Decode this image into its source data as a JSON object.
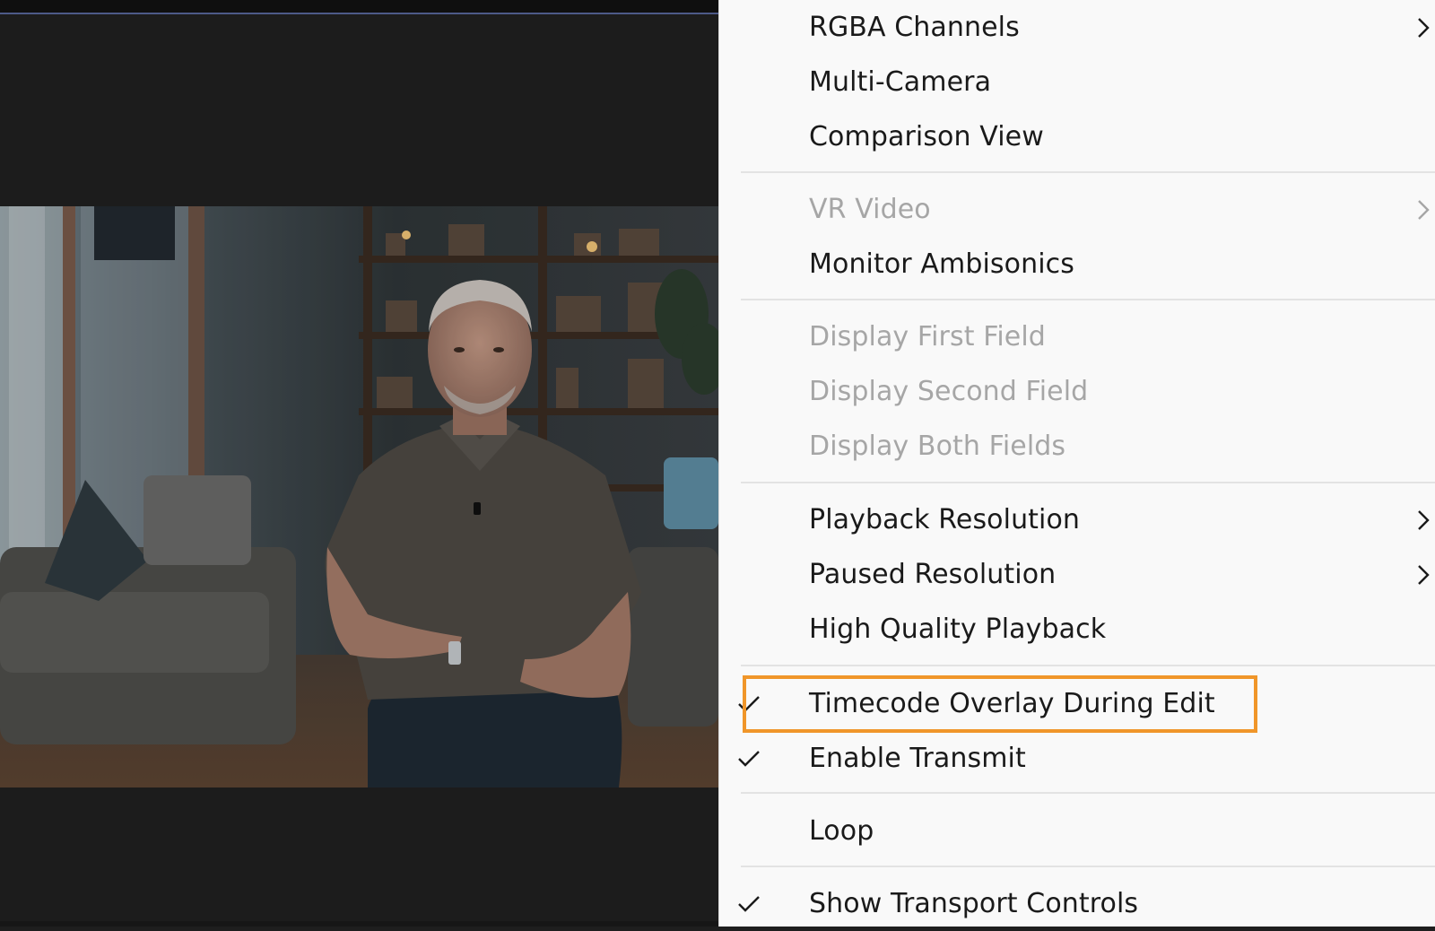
{
  "monitor": {
    "preview_name": "video-preview"
  },
  "menu": {
    "items": [
      {
        "label": "RGBA Channels",
        "enabled": true,
        "checked": false,
        "submenu": true
      },
      {
        "label": "Multi-Camera",
        "enabled": true,
        "checked": false,
        "submenu": false
      },
      {
        "label": "Comparison View",
        "enabled": true,
        "checked": false,
        "submenu": false
      },
      {
        "label": "VR Video",
        "enabled": false,
        "checked": false,
        "submenu": true
      },
      {
        "label": "Monitor Ambisonics",
        "enabled": true,
        "checked": false,
        "submenu": false
      },
      {
        "label": "Display First Field",
        "enabled": false,
        "checked": false,
        "submenu": false
      },
      {
        "label": "Display Second Field",
        "enabled": false,
        "checked": false,
        "submenu": false
      },
      {
        "label": "Display Both Fields",
        "enabled": false,
        "checked": false,
        "submenu": false
      },
      {
        "label": "Playback Resolution",
        "enabled": true,
        "checked": false,
        "submenu": true
      },
      {
        "label": "Paused Resolution",
        "enabled": true,
        "checked": false,
        "submenu": true
      },
      {
        "label": "High Quality Playback",
        "enabled": true,
        "checked": false,
        "submenu": false
      },
      {
        "label": "Timecode Overlay During Edit",
        "enabled": true,
        "checked": true,
        "submenu": false,
        "highlighted": true
      },
      {
        "label": "Enable Transmit",
        "enabled": true,
        "checked": true,
        "submenu": false
      },
      {
        "label": "Loop",
        "enabled": true,
        "checked": false,
        "submenu": false
      },
      {
        "label": "Show Transport Controls",
        "enabled": true,
        "checked": true,
        "submenu": false
      }
    ]
  },
  "colors": {
    "highlight": "#f0962a",
    "menu_bg": "#f9f9f9",
    "text": "#1a1a1a",
    "disabled_text": "#a6a6a6"
  }
}
